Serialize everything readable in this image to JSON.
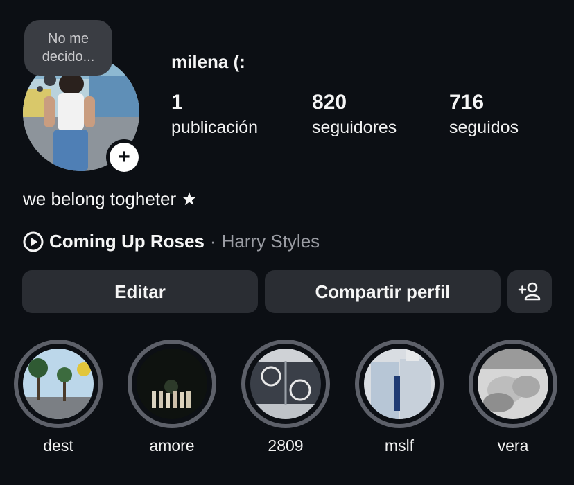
{
  "note": {
    "text_line1": "No me",
    "text_line2": "decido..."
  },
  "profile": {
    "username": "milena (:",
    "stats": [
      {
        "value": "1",
        "label": "publicación"
      },
      {
        "value": "820",
        "label": "seguidores"
      },
      {
        "value": "716",
        "label": "seguidos"
      }
    ],
    "bio": "we belong togheter ★",
    "music": {
      "song": "Coming Up Roses",
      "separator": "·",
      "artist": "Harry Styles"
    }
  },
  "actions": {
    "edit_label": "Editar",
    "share_label": "Compartir perfil",
    "add_user_icon": "person-add-icon"
  },
  "highlights": [
    {
      "label": "dest"
    },
    {
      "label": "amore"
    },
    {
      "label": "2809"
    },
    {
      "label": "mslf"
    },
    {
      "label": "vera"
    }
  ],
  "colors": {
    "background": "#0c0f14",
    "button_bg": "#2a2d33",
    "note_bg": "#3a3d43",
    "highlight_ring": "#5d6069",
    "muted_text": "#9a9ca3"
  }
}
